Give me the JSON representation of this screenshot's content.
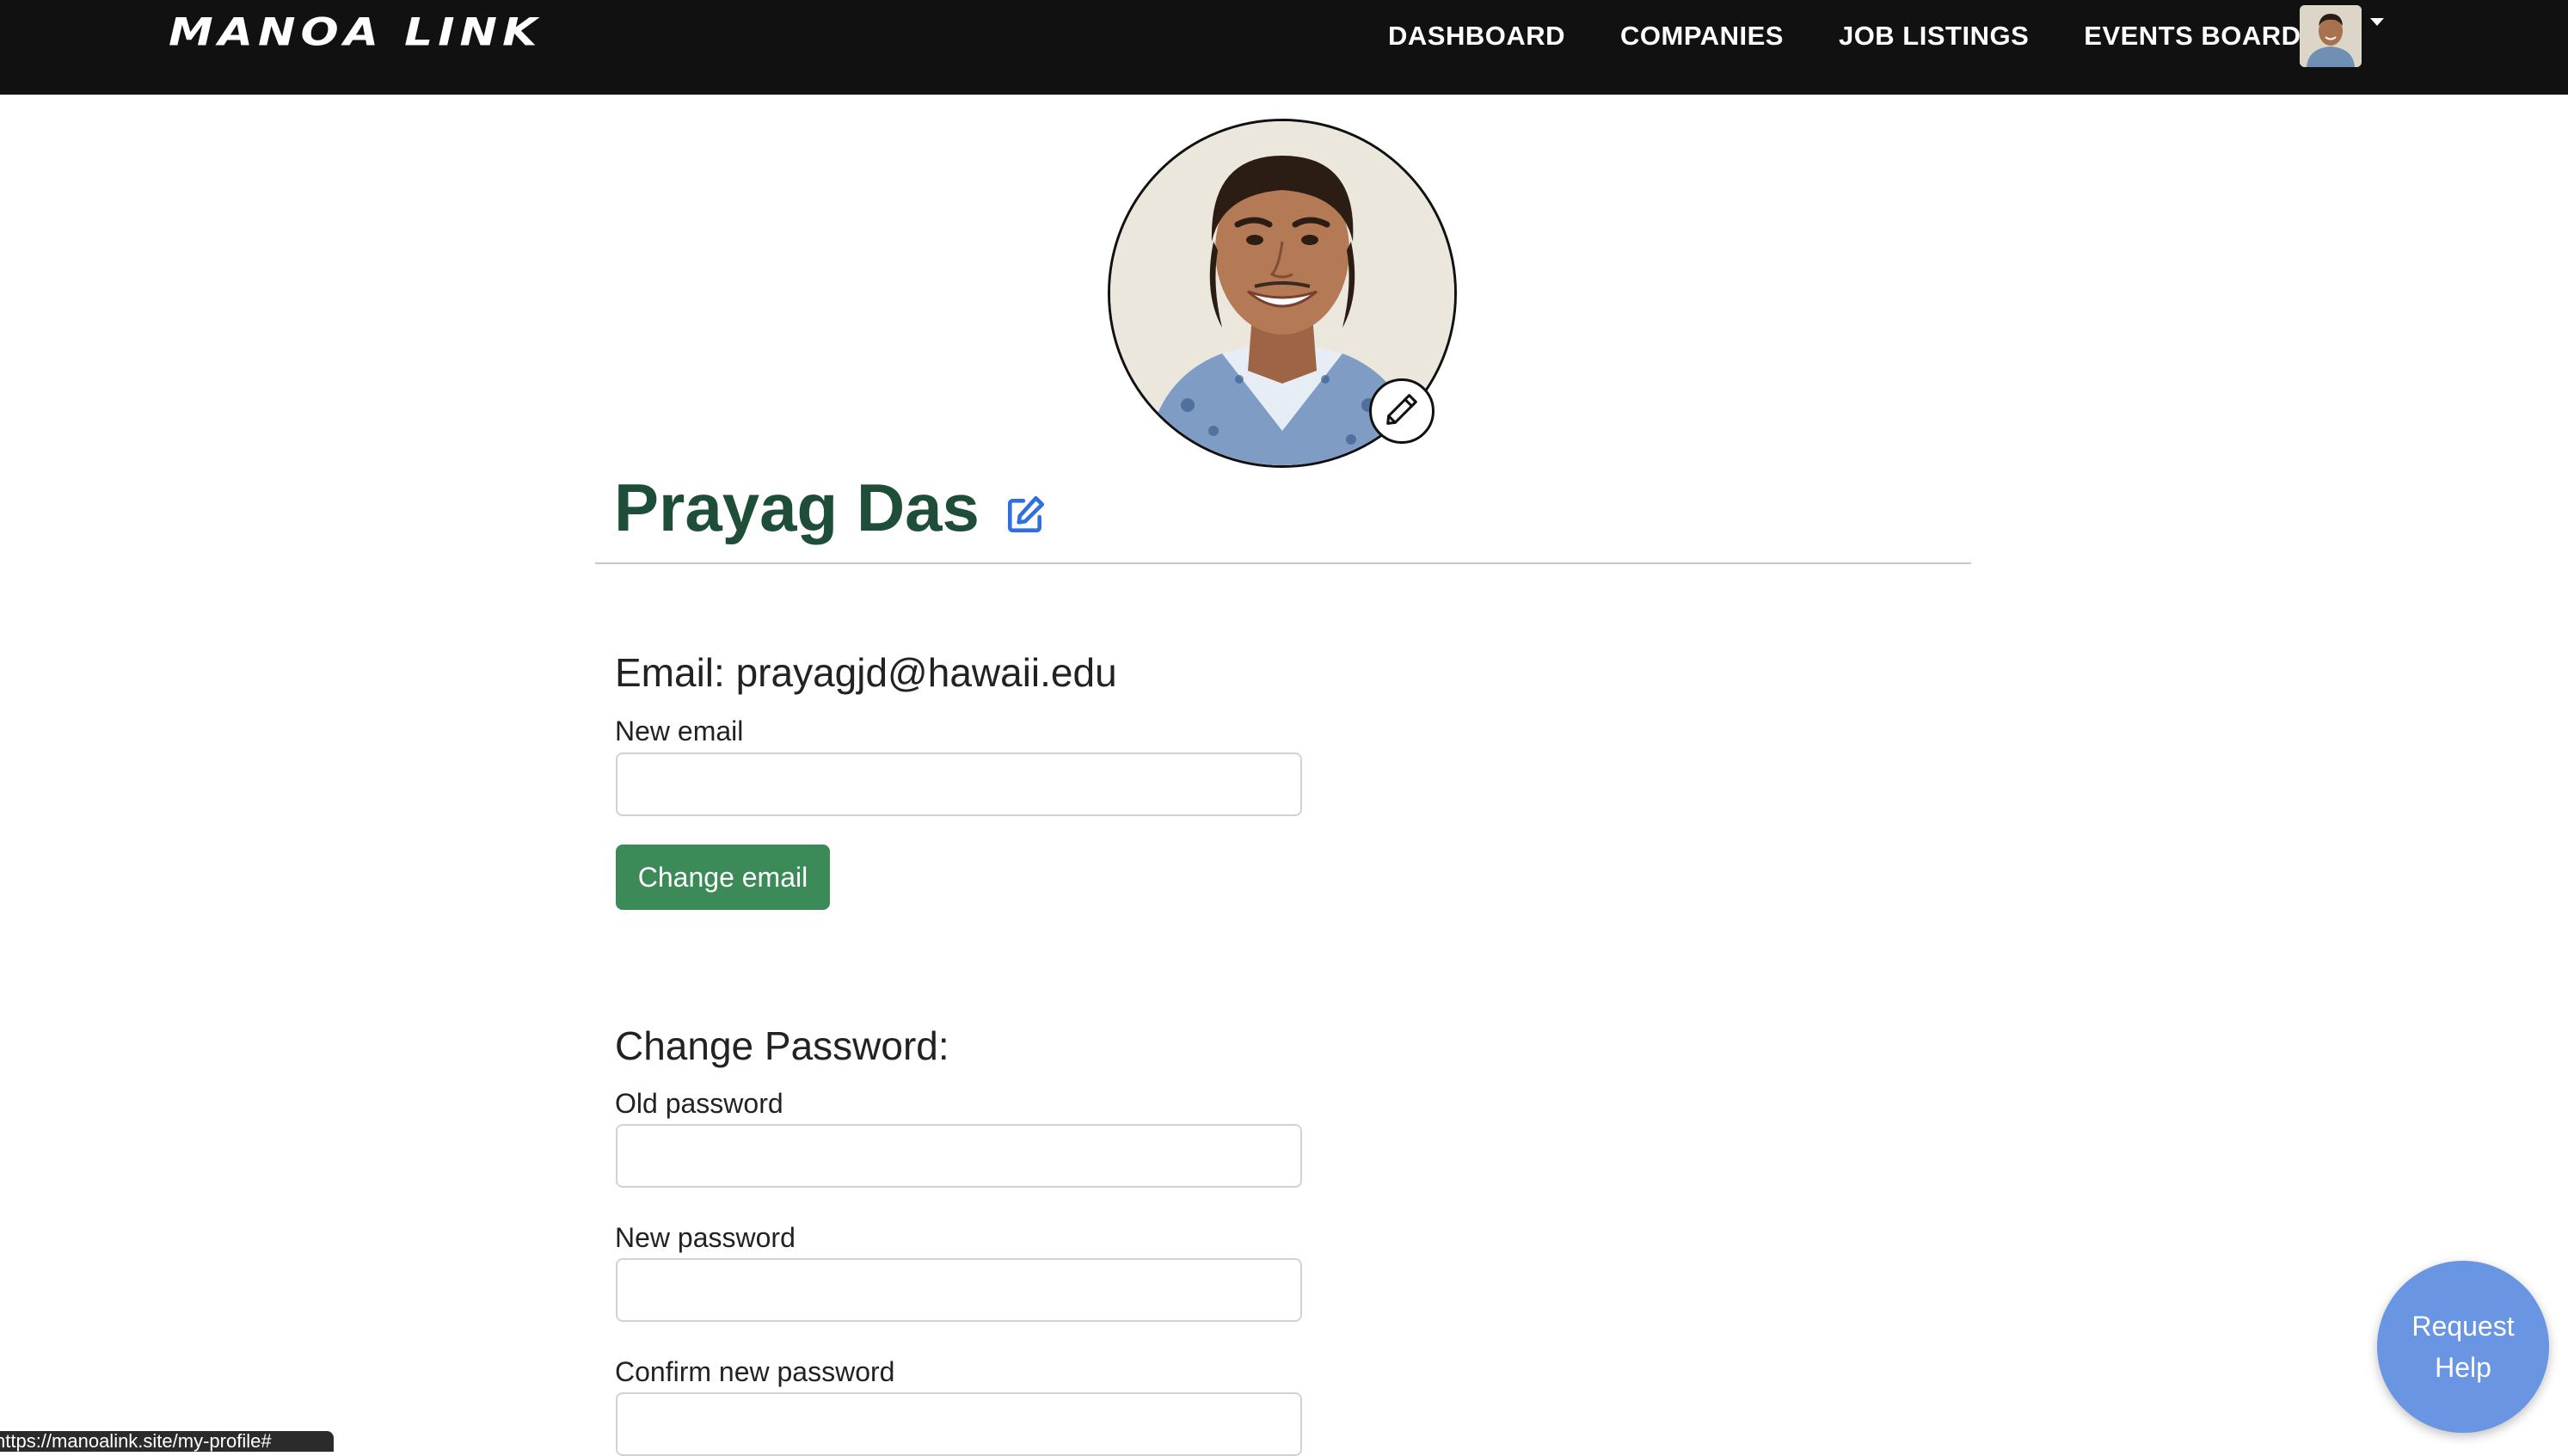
{
  "nav": {
    "logo": "MANOA LINK",
    "links": [
      "DASHBOARD",
      "COMPANIES",
      "JOB LISTINGS",
      "EVENTS BOARD"
    ]
  },
  "profile": {
    "name": "Prayag Das"
  },
  "email_section": {
    "title": "Email: prayagjd@hawaii.edu",
    "new_email_label": "New email",
    "new_email_value": "",
    "change_button": "Change email"
  },
  "password_section": {
    "title": "Change Password:",
    "old_label": "Old password",
    "new_label": "New password",
    "confirm_label": "Confirm new password"
  },
  "help_button": {
    "line1": "Request",
    "line2": "Help"
  },
  "status_url": "https://manoalink.site/my-profile#",
  "colors": {
    "navbar": "#111111",
    "name": "#1e4d38",
    "button_green": "#3b8a57",
    "help_blue": "#6a95e3",
    "edit_icon_blue": "#2f6fe0"
  }
}
